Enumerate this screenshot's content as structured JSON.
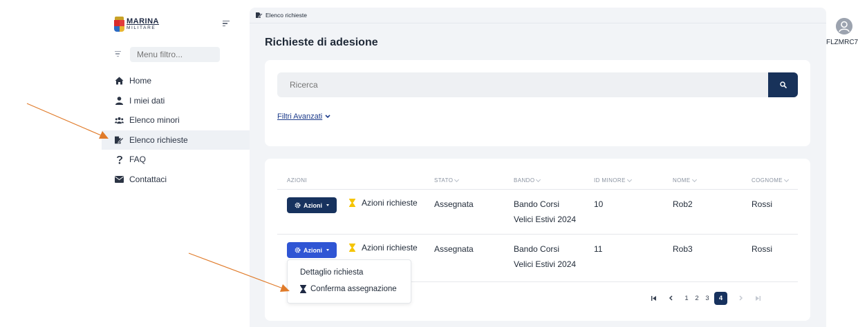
{
  "logo": {
    "line1": "MARINA",
    "line2": "MILITARE"
  },
  "sidebar": {
    "filter_placeholder": "Menu filtro...",
    "items": [
      {
        "label": "Home",
        "icon": "home-icon"
      },
      {
        "label": "I miei dati",
        "icon": "user-icon"
      },
      {
        "label": "Elenco minori",
        "icon": "users-icon"
      },
      {
        "label": "Elenco richieste",
        "icon": "file-signature-icon",
        "active": true
      },
      {
        "label": "FAQ",
        "icon": "question-icon"
      },
      {
        "label": "Contattaci",
        "icon": "envelope-icon"
      }
    ]
  },
  "breadcrumb": {
    "label": "Elenco richieste"
  },
  "page": {
    "title": "Richieste di adesione"
  },
  "search": {
    "placeholder": "Ricerca",
    "advanced_filters": "Filtri Avanzati"
  },
  "table": {
    "headers": {
      "azioni": "AZIONI",
      "stato": "STATO",
      "bando": "BANDO",
      "id_minore": "ID MINORE",
      "nome": "NOME",
      "cognome": "COGNOME"
    },
    "actions_button_label": "Azioni",
    "rows": [
      {
        "action_link": "Azioni richieste",
        "stato": "Assegnata",
        "bando_line1": "Bando Corsi",
        "bando_line2": "Velici Estivi 2024",
        "id_minore": "10",
        "nome": "Rob2",
        "cognome": "Rossi"
      },
      {
        "action_link": "Azioni richieste",
        "stato": "Assegnata",
        "bando_line1": "Bando Corsi",
        "bando_line2": "Velici Estivi 2024",
        "id_minore": "11",
        "nome": "Rob3",
        "cognome": "Rossi"
      }
    ],
    "dropdown": {
      "items": [
        {
          "label": "Dettaglio richiesta"
        },
        {
          "label": "Conferma assegnazione",
          "icon": "hourglass-icon"
        }
      ]
    }
  },
  "pagination": {
    "pages": [
      "1",
      "2",
      "3",
      "4"
    ],
    "current": "4"
  },
  "user": {
    "code": "FLZMRC7"
  },
  "colors": {
    "primary": "#17325e",
    "dropdown_active": "#2f55d4",
    "hourglass": "#f5c400",
    "annotation_arrow": "#e07b2a"
  }
}
